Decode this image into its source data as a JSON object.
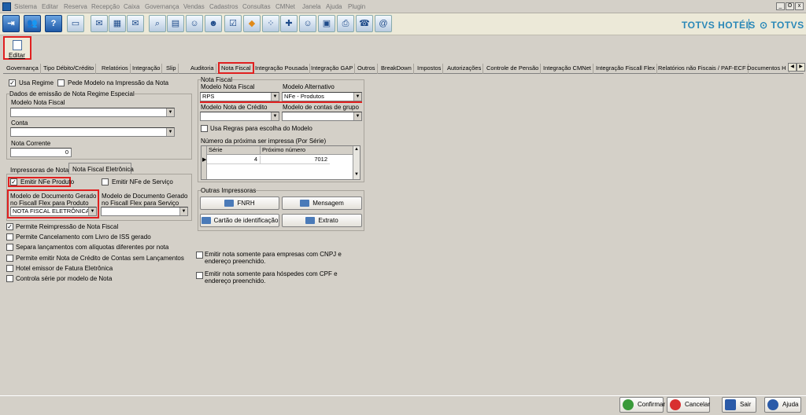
{
  "menu": [
    "Sistema",
    "Editar",
    "Reserva",
    "Recepção",
    "Caixa",
    "Governança",
    "Vendas",
    "Cadastros",
    "Consultas",
    "CMNet",
    "Janela",
    "Ajuda",
    "Plugin"
  ],
  "window_controls": [
    "_",
    "ʘ",
    "x"
  ],
  "toolbar_icons": [
    "exit-icon",
    "users-icon",
    "help-icon",
    "computer-icon",
    "mail-icon",
    "spreadsheet-icon",
    "mail-forward-icon",
    "search-icon",
    "calendar-icon",
    "people-icon",
    "person-card-icon",
    "checklist-icon",
    "bell-icon",
    "footprints-icon",
    "add-group-icon",
    "guests-icon",
    "cash-register-icon",
    "printer-icon",
    "operator-icon",
    "web-mail-icon"
  ],
  "brand": {
    "logo1": "TOTVS HOTÉIS",
    "logo2": "TOTVS"
  },
  "edit_label": "Editar",
  "tabs": [
    "Governança",
    "Tipo Débito/Crédito",
    "Relatórios",
    "Integração",
    "Slip",
    "Auditoria",
    "Nota Fiscal",
    "Integração Pousada",
    "Integração GAP",
    "Outros",
    "BreakDown",
    "Impostos",
    "Autorizações",
    "Controle de Pensão",
    "Integração CMNet",
    "Integração Fiscall Flex",
    "Relatórios não Fiscais / PAF-ECF",
    "Documentos H"
  ],
  "left": {
    "usa_regime": "Usa Regime",
    "pede_modelo": "Pede Modelo na Impressão da Nota",
    "dados_title": "Dados de emissão de Nota Regime Especial",
    "modelo_nf": "Modelo Nota Fiscal",
    "conta": "Conta",
    "nota_corrente": "Nota Corrente",
    "nota_corrente_val": "0",
    "subtabs": [
      "Impressoras de Notas",
      "Nota Fiscal Eletrônica"
    ],
    "emitir_nfe_prod": "Emitir NFe Produto",
    "emitir_nfe_serv": "Emitir NFe de Serviço",
    "modelo_prod": "Modelo de Documento Gerado no Fiscall Flex para Produto",
    "modelo_serv": "Modelo de Documento Gerado no Fiscall Flex para Serviço",
    "modelo_prod_val": "NOTA FISCAL ELETRÔNICA",
    "options": [
      "Permite Reimpressão de Nota Fiscal",
      "Permite Cancelamento com Livro de ISS gerado",
      "Separa lançamentos com alíquotas diferentes por nota",
      "Permite emitir Nota de Crédito de Contas sem Lançamentos",
      "Hotel emissor de Fatura Eletrônica",
      "Controla série por modelo de Nota"
    ]
  },
  "nf": {
    "title": "Nota Fiscal",
    "modelo_nf": "Modelo Nota Fiscal",
    "modelo_nf_val": "RPS",
    "modelo_alt": "Modelo Alternativo",
    "modelo_alt_val": "NFe - Produtos",
    "modelo_credito": "Modelo Nota de Crédito",
    "modelo_grupo": "Modelo de contas de grupo",
    "usa_regras": "Usa Regras para escolha do Modelo",
    "proxima": "Número da próxima ser impressa (Por Série)",
    "grid_headers": [
      "Série",
      "Próximo número"
    ],
    "grid_row": [
      "4",
      "7012"
    ]
  },
  "outras": {
    "title": "Outras Impressoras",
    "buttons": [
      "FNRH",
      "Mensagem",
      "Cartão de identificação",
      "Extrato"
    ]
  },
  "emitir_cnpj": "Emitir nota somente para empresas com CNPJ e endereço preenchido.",
  "emitir_cpf": "Emitir nota somente para hóspedes com CPF e endereço preenchido.",
  "bottom": {
    "confirmar": "Confirmar",
    "cancelar": "Cancelar",
    "sair": "Sair",
    "ajuda": "Ajuda"
  }
}
